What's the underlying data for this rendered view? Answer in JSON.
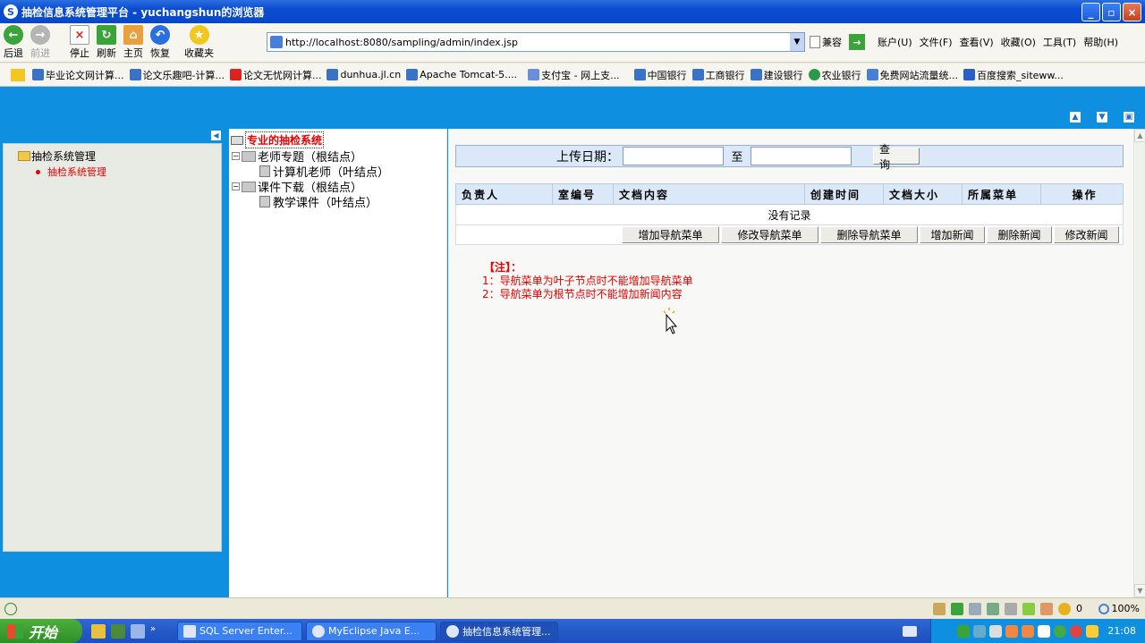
{
  "window": {
    "title": "抽检信息系统管理平台 - yuchangshun的浏览器"
  },
  "toolbar": {
    "back": "后退",
    "forward": "前进",
    "stop": "停止",
    "refresh": "刷新",
    "home": "主页",
    "restore": "恢复",
    "favorites": "收藏夹",
    "address": "http://localhost:8080/sampling/admin/index.jsp",
    "compat": "兼容",
    "menus": [
      "账户(U)",
      "文件(F)",
      "查看(V)",
      "收藏(O)",
      "工具(T)",
      "帮助(H)"
    ]
  },
  "favbar": {
    "items": [
      "毕业论文网计算...",
      "论文乐趣吧-计算...",
      "论文无忧网计算...",
      "dunhua.jl.cn",
      "Apache Tomcat-5....",
      "支付宝 - 网上支...",
      "中国银行",
      "工商银行",
      "建设银行",
      "农业银行",
      "免费网站流量统...",
      "百度搜索_siteww..."
    ]
  },
  "left": {
    "header": "抽检系统管理",
    "item": "抽检系统管理"
  },
  "tree": {
    "root": "专业的抽检系统",
    "nodes": [
      {
        "label": "老师专题（根结点）",
        "child": "计算机老师（叶结点）"
      },
      {
        "label": "课件下载（根结点）",
        "child": "教学课件（叶结点）"
      }
    ]
  },
  "search": {
    "label": "上传日期：",
    "to": "至",
    "button": "查 询",
    "from_value": "",
    "to_value": ""
  },
  "grid": {
    "headers": [
      "负责人",
      "室编号",
      "文档内容",
      "创建时间",
      "文档大小",
      "所属菜单",
      "操作"
    ],
    "empty": "没有记录"
  },
  "ops": {
    "buttons": [
      "增加导航菜单",
      "修改导航菜单",
      "删除导航菜单",
      "增加新闻",
      "删除新闻",
      "修改新闻"
    ]
  },
  "notes": {
    "title": "【注】：",
    "lines": [
      "1：导航菜单为叶子节点时不能增加导航菜单",
      "2：导航菜单为根节点时不能增加新闻内容"
    ]
  },
  "statusbar": {
    "zoom": "100%",
    "count": "0"
  },
  "taskbar": {
    "start": "开始",
    "tasks": [
      "SQL Server Enter...",
      "MyEclipse Java E...",
      "抽检信息系统管理..."
    ],
    "time": "21:08"
  }
}
